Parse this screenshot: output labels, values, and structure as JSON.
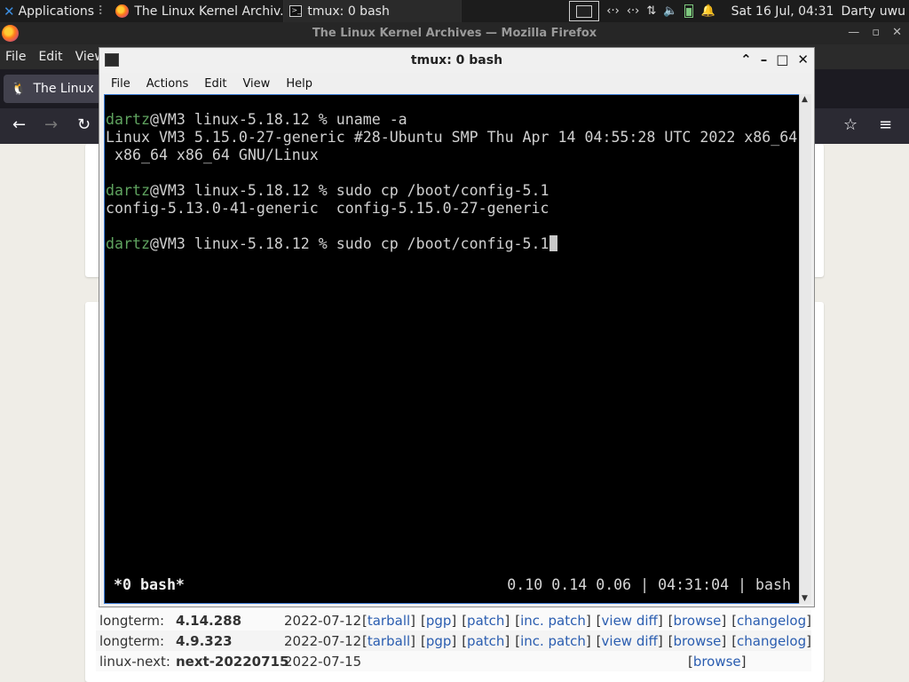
{
  "panel": {
    "applications_label": "Applications",
    "task1_label": "The Linux Kernel Archiv...",
    "task2_label": "tmux: 0 bash",
    "clock": "Sat 16 Jul, 04:31",
    "user": "Darty uwu"
  },
  "firefox": {
    "window_title": "The Linux Kernel Archives — Mozilla Firefox",
    "menu": [
      "File",
      "Edit",
      "View"
    ],
    "tab_label": "The Linux K",
    "releases": [
      {
        "type": "longterm:",
        "version": "4.14.288",
        "date": "2022-07-12",
        "links": [
          "tarball",
          "pgp",
          "patch",
          "inc. patch",
          "view diff",
          "browse",
          "changelog"
        ]
      },
      {
        "type": "longterm:",
        "version": "4.9.323",
        "date": "2022-07-12",
        "links": [
          "tarball",
          "pgp",
          "patch",
          "inc. patch",
          "view diff",
          "browse",
          "changelog"
        ]
      },
      {
        "type": "linux-next:",
        "version": "next-20220715",
        "date": "2022-07-15",
        "links": [
          "",
          "",
          "",
          "",
          "",
          "browse",
          ""
        ]
      }
    ]
  },
  "terminal": {
    "title": "tmux: 0 bash",
    "menu": [
      "File",
      "Actions",
      "Edit",
      "View",
      "Help"
    ],
    "lines": [
      {
        "user": "dartz",
        "rest": "@VM3 linux-5.18.12 % uname -a"
      },
      {
        "user": "",
        "rest": "Linux VM3 5.15.0-27-generic #28-Ubuntu SMP Thu Apr 14 04:55:28 UTC 2022 x86_64"
      },
      {
        "user": "",
        "rest": " x86_64 x86_64 GNU/Linux"
      },
      {
        "user": "",
        "rest": ""
      },
      {
        "user": "dartz",
        "rest": "@VM3 linux-5.18.12 % sudo cp /boot/config-5.1"
      },
      {
        "user": "",
        "rest": "config-5.13.0-41-generic  config-5.15.0-27-generic"
      },
      {
        "user": "",
        "rest": ""
      },
      {
        "user": "dartz",
        "rest": "@VM3 linux-5.18.12 % sudo cp /boot/config-5.1"
      }
    ],
    "status_window": "*0 bash*",
    "status_right": "0.10 0.14 0.06 | 04:31:04 | bash"
  }
}
